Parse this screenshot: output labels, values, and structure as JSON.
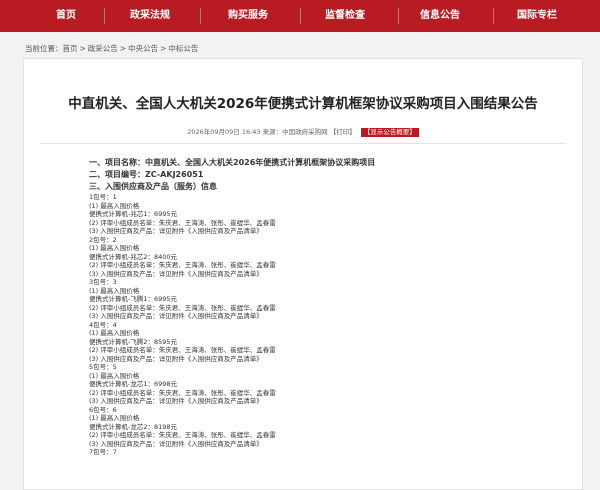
{
  "nav": {
    "items": [
      "首页",
      "政采法规",
      "购买服务",
      "监督检查",
      "信息公告",
      "国际专栏"
    ],
    "color": "#b81c22"
  },
  "breadcrumb": {
    "prefix": "当前位置：",
    "items": [
      "首页",
      "政采公告",
      "中央公告",
      "中标公告"
    ],
    "separator": ">"
  },
  "article": {
    "title": "中直机关、全国人大机关2026年便携式计算机框架协议采购项目入围结果公告",
    "date": "2026年09月09日 16:43",
    "source": "来源：中国政府采购网",
    "print": "【打印】",
    "show_summary": "【显示公告概要】",
    "headings": [
      "一、项目名称：中直机关、全国人大机关2026年便携式计算机框架协议采购项目",
      "二、项目编号：ZC-AKJ26051",
      "三、入围供应商及产品（服务）信息"
    ],
    "lines": [
      "1包号：1",
      "(1) 最高入围价格",
      "便携式计算机-兆芯1：6995元",
      "(2) 评审小组成员名单：朱庆君、王海涛、张彤、崔缇华、孟春雷",
      "(3) 入围供应商及产品：详见附件《入围供应商及产品清单》",
      "2包号：2",
      "(1) 最高入围价格",
      "便携式计算机-兆芯2：8400元",
      "(2) 评审小组成员名单：朱庆君、王海涛、张彤、崔缇华、孟春雷",
      "(3) 入围供应商及产品：详见附件《入围供应商及产品清单》",
      "3包号：3",
      "(1) 最高入围价格",
      "便携式计算机-飞腾1：6995元",
      "(2) 评审小组成员名单：朱庆君、王海涛、张彤、崔缇华、孟春雷",
      "(3) 入围供应商及产品：详见附件《入围供应商及产品清单》",
      "4包号：4",
      "(1) 最高入围价格",
      "便携式计算机-飞腾2：8595元",
      "(2) 评审小组成员名单：朱庆君、王海涛、张彤、崔缇华、孟春雷",
      "(3) 入围供应商及产品：详见附件《入围供应商及产品清单》",
      "5包号：5",
      "(1) 最高入围价格",
      "便携式计算机-龙芯1：6998元",
      "(2) 评审小组成员名单：朱庆君、王海涛、张彤、崔缇华、孟春雷",
      "(3) 入围供应商及产品：详见附件《入围供应商及产品清单》",
      "6包号：6",
      "(1) 最高入围价格",
      "便携式计算机-龙芯2：8198元",
      "(2) 评审小组成员名单：朱庆君、王海涛、张彤、崔缇华、孟春雷",
      "(3) 入围供应商及产品：详见附件《入围供应商及产品清单》",
      "7包号：7"
    ]
  }
}
